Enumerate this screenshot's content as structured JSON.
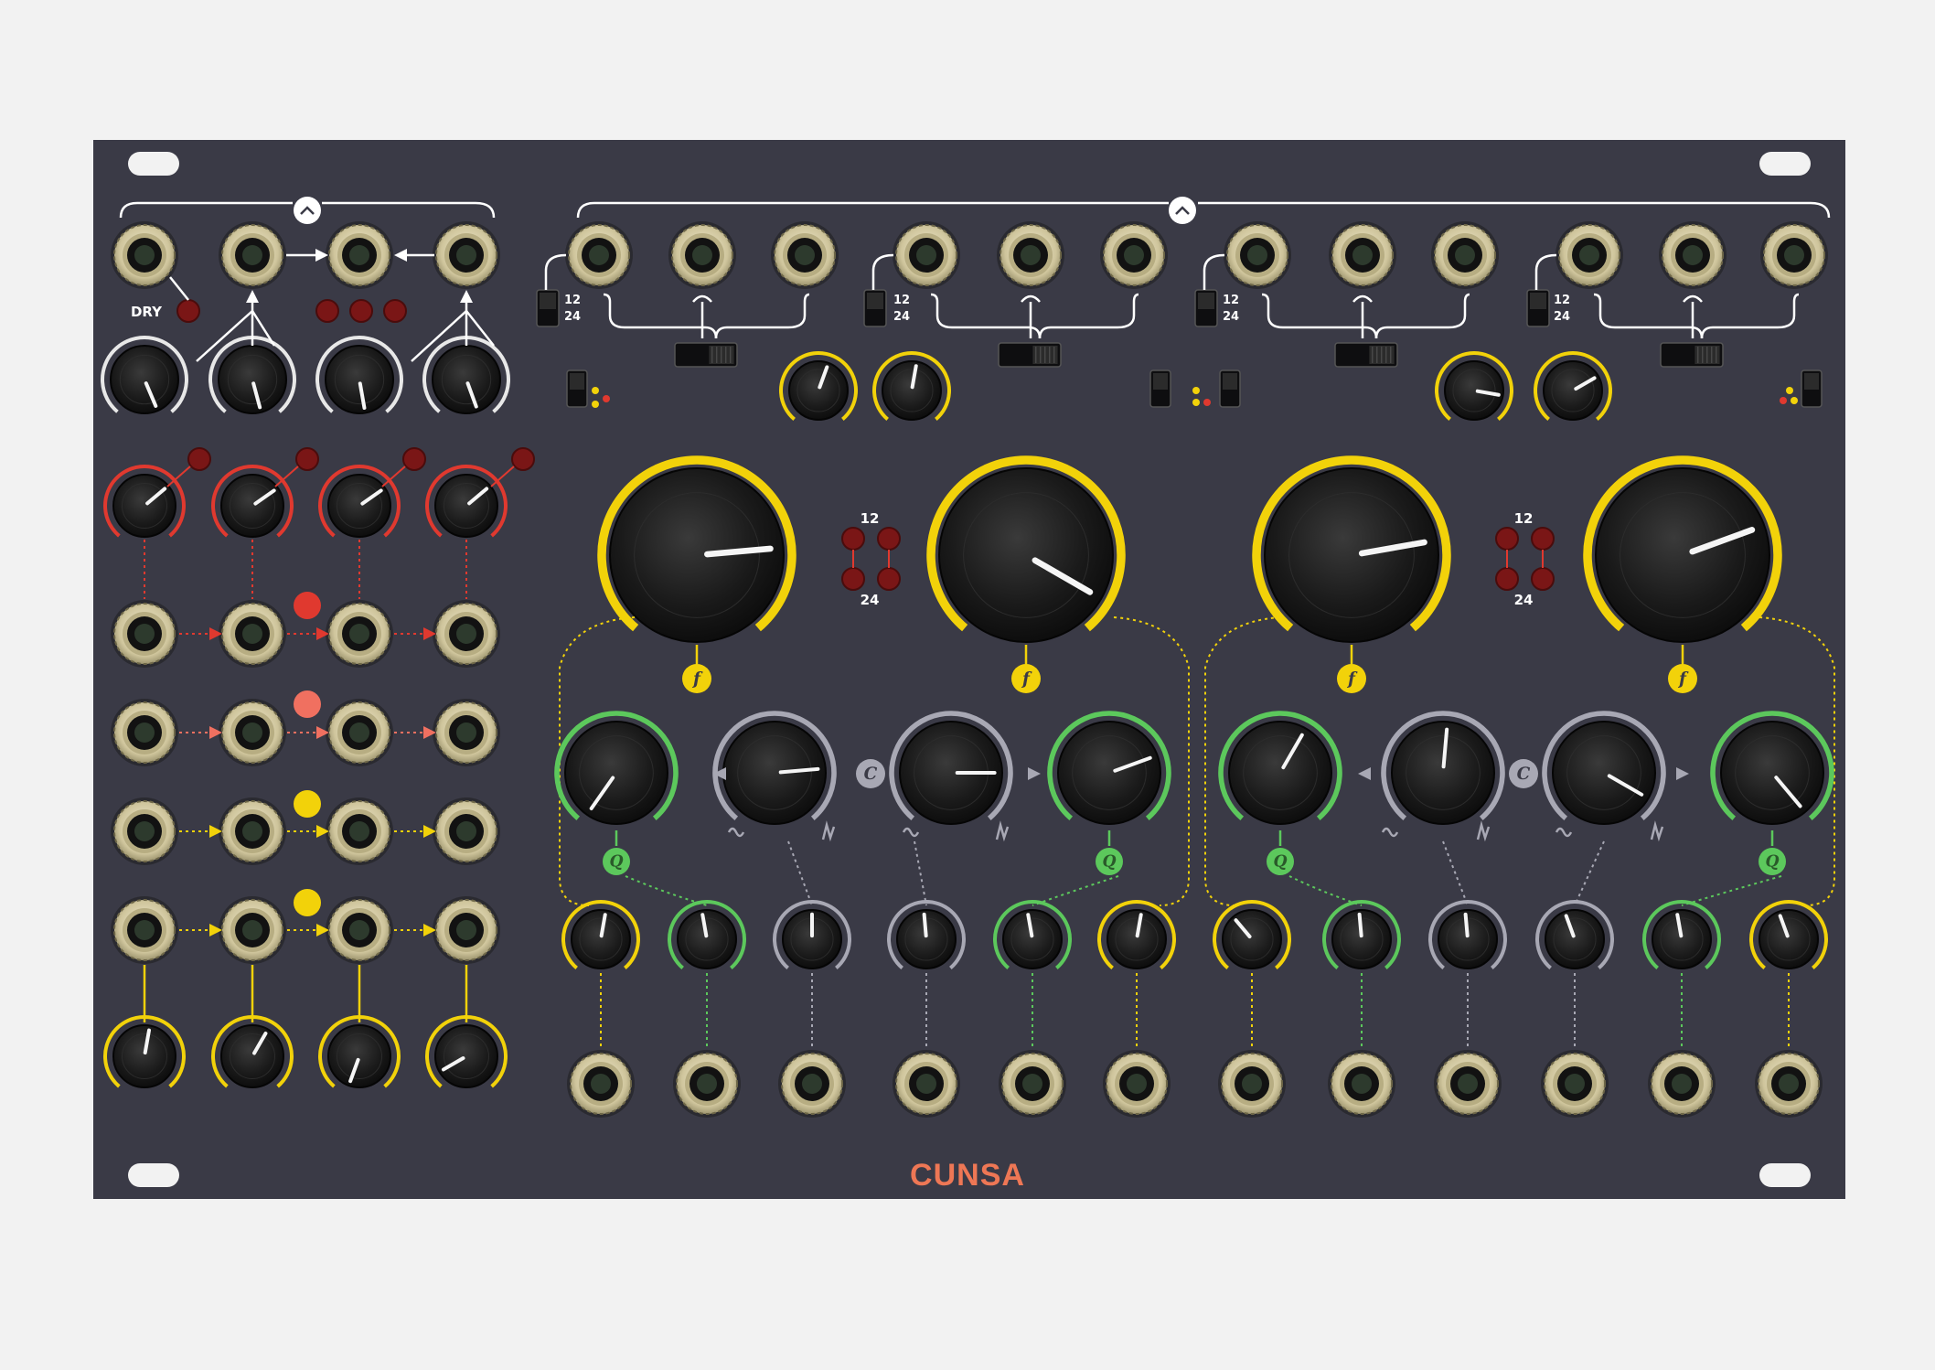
{
  "panel": {
    "brand": "CUNSA",
    "brand_color": "#ee7755",
    "panel_color": "#3a3a46",
    "background_color": "#f2f2f2"
  },
  "mixer": {
    "dry_label": "DRY",
    "rows": [
      {
        "name": "red",
        "color": "#e0392f"
      },
      {
        "name": "salmon",
        "color": "#f07060"
      },
      {
        "name": "yellow",
        "color": "#f2d20a"
      },
      {
        "name": "yellow-env",
        "color": "#f2d20a"
      }
    ]
  },
  "filters": [
    {
      "name": "filter-1",
      "color": "#f2d20a",
      "slope_labels": [
        "12",
        "24"
      ]
    },
    {
      "name": "filter-2",
      "color": "#f2d20a",
      "slope_labels": [
        "12",
        "24"
      ]
    },
    {
      "name": "filter-3",
      "color": "#f2d20a",
      "slope_labels": [
        "12",
        "24"
      ]
    },
    {
      "name": "filter-4",
      "color": "#f2d20a",
      "slope_labels": [
        "12",
        "24"
      ]
    }
  ],
  "slope_indicator": {
    "labels": [
      "12",
      "24"
    ]
  },
  "symbols": {
    "frequency": "f",
    "resonance": "Q",
    "coupling": "C"
  },
  "colors": {
    "frequency": "#f2d20a",
    "resonance": "#5cc85c",
    "morph": "#a8a8b4",
    "led_red": "#7a1616",
    "jack_metal": "#d8cfa8"
  }
}
